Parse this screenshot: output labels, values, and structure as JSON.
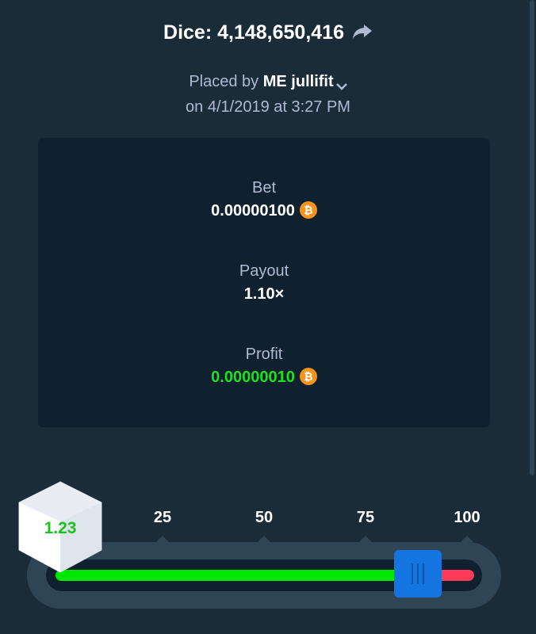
{
  "header": {
    "title": "Dice: 4,148,650,416",
    "placed_prefix": "Placed by",
    "username": "ME jullifit",
    "date": "on 4/1/2019 at 3:27 PM"
  },
  "bet": {
    "label": "Bet",
    "value": "0.00000100",
    "currency_symbol": "₿"
  },
  "payout": {
    "label": "Payout",
    "value": "1.10×"
  },
  "profit": {
    "label": "Profit",
    "value": "0.00000010",
    "currency_symbol": "₿"
  },
  "slider": {
    "ticks": [
      "25",
      "50",
      "75",
      "100"
    ],
    "result": "1.23",
    "handle_position_percent": 82
  },
  "colors": {
    "background": "#1a2c38",
    "card": "#0f212e",
    "win_green": "#00e701",
    "lose_red": "#ff3a58",
    "handle_blue": "#1475e1",
    "btc_orange": "#f7931a"
  },
  "icons": {
    "share": "share-arrow-icon",
    "chevron": "chevron-down-icon",
    "coin": "bitcoin-icon",
    "dice": "dice-cube-icon"
  }
}
